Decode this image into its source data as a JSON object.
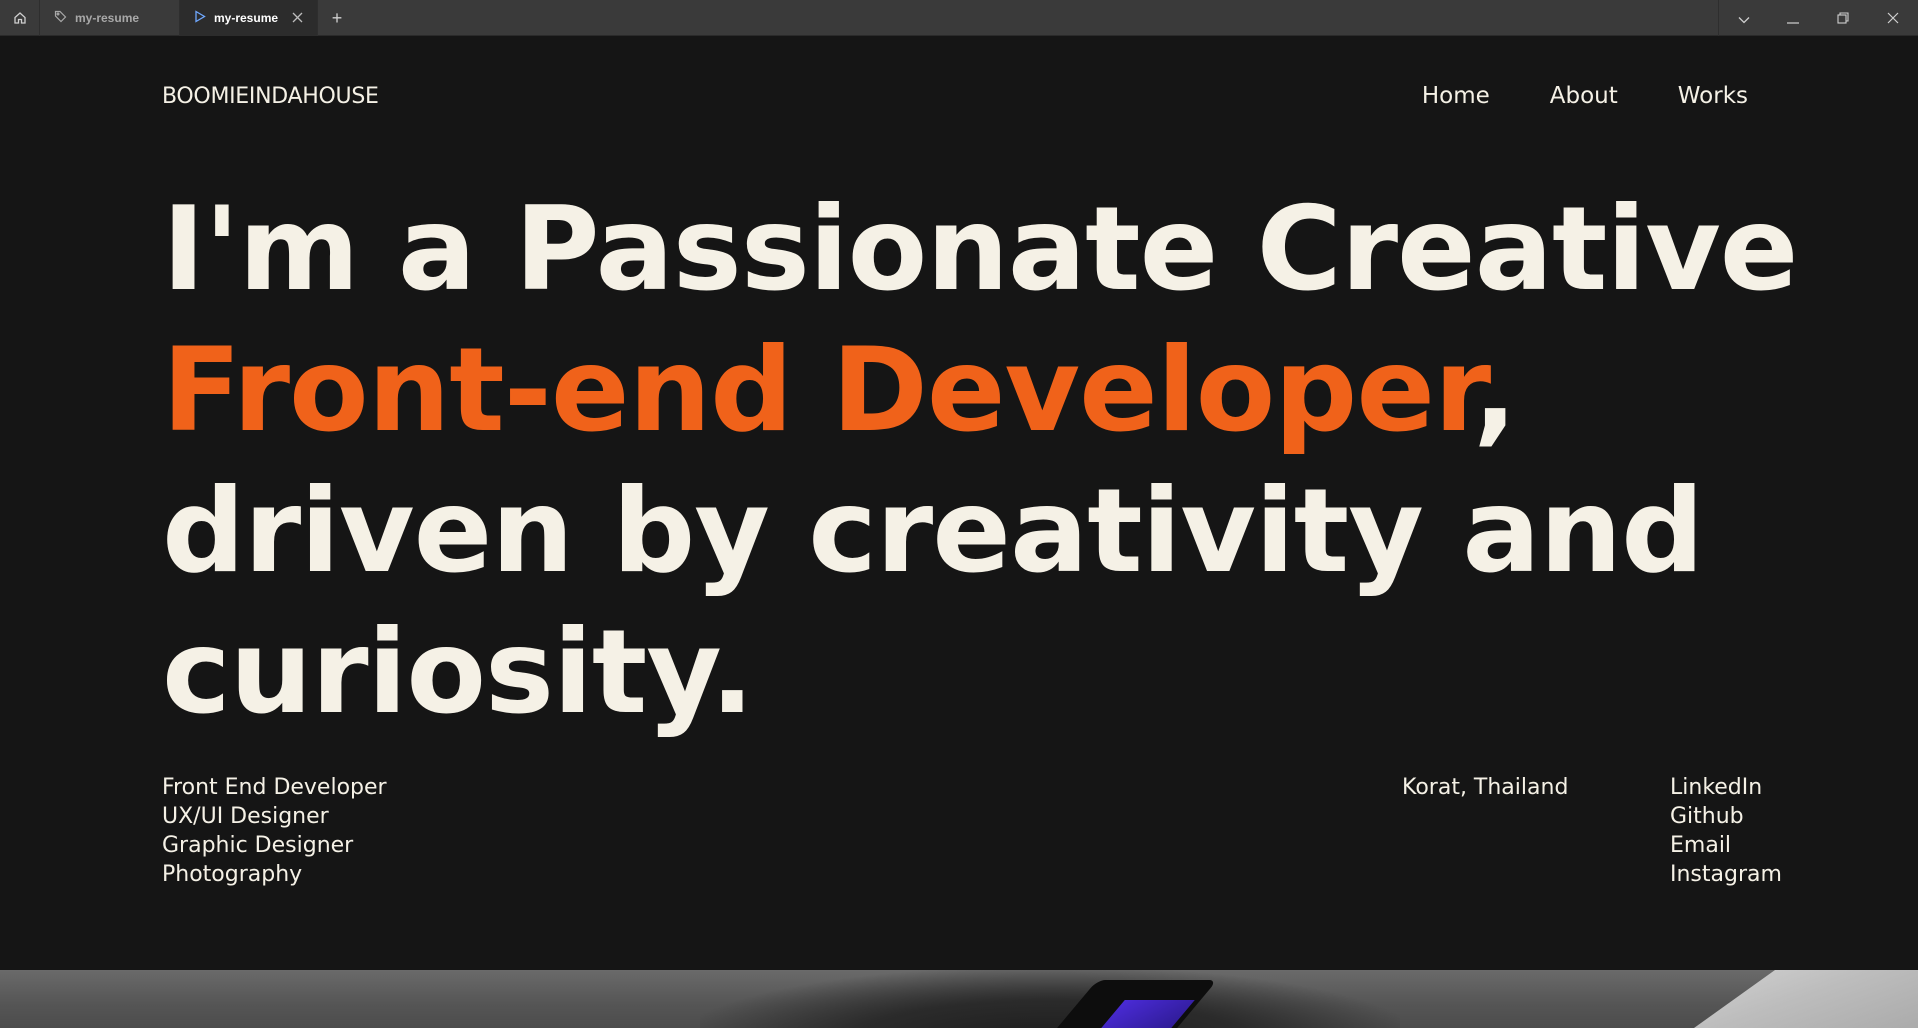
{
  "browser": {
    "tabs": [
      {
        "label": "my-resume",
        "active": false,
        "icon": "tag-icon"
      },
      {
        "label": "my-resume",
        "active": true,
        "icon": "play-icon"
      }
    ],
    "new_tab": "+"
  },
  "site": {
    "brand": "BOOMIEINDAHOUSE",
    "nav": [
      "Home",
      "About",
      "Works"
    ]
  },
  "hero": {
    "line1": "I'm a Passionate Creative",
    "accent": "Front-end Developer",
    "accent_suffix": ",",
    "line3": "driven by creativity and",
    "line4": "curiosity."
  },
  "roles": [
    "Front End Developer",
    "UX/UI Designer",
    "Graphic Designer",
    "Photography"
  ],
  "location": "Korat, Thailand",
  "socials": [
    "LinkedIn",
    "Github",
    "Email",
    "Instagram"
  ],
  "colors": {
    "background": "#151515",
    "text": "#f5f1e6",
    "accent": "#f0621a"
  }
}
